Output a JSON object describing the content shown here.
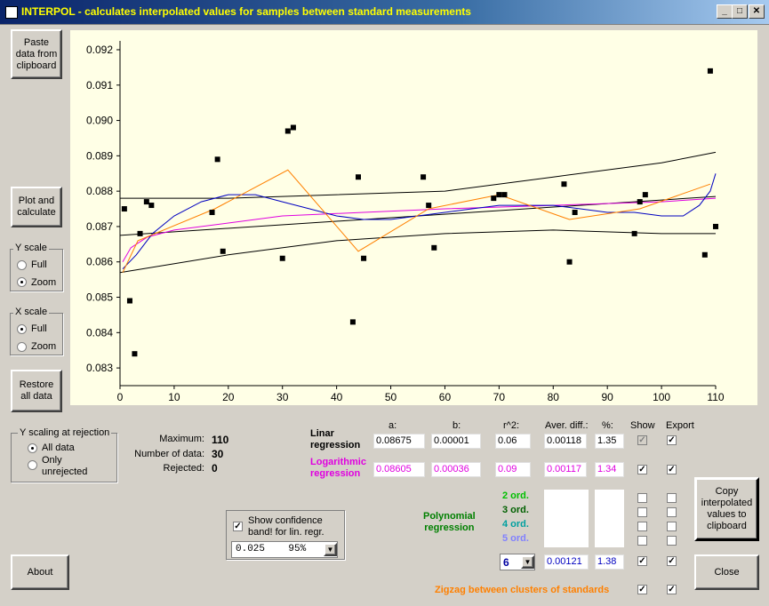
{
  "window": {
    "title": "INTERPOL - calculates interpolated values for samples between standard measurements"
  },
  "buttons": {
    "paste": "Paste\ndata from\nclipboard",
    "plot": "Plot and\ncalculate",
    "restore": "Restore\nall data",
    "about": "About",
    "copy": "Copy\ninterpolated\nvalues to\nclipboard",
    "close": "Close"
  },
  "yscale": {
    "title": "Y scale",
    "options": [
      "Full",
      "Zoom"
    ],
    "selected": "Zoom"
  },
  "xscale": {
    "title": "X scale",
    "options": [
      "Full",
      "Zoom"
    ],
    "selected": "Full"
  },
  "yreject": {
    "title": "Y scaling at rejection",
    "opt1": "All data",
    "opt2": "Only\nunrejected",
    "selected": "All data"
  },
  "stats": {
    "max_label": "Maximum:",
    "max": "110",
    "n_label": "Number of data:",
    "n": "30",
    "rej_label": "Rejected:",
    "rej": "0"
  },
  "headers": {
    "a": "a:",
    "b": "b:",
    "r2": "r^2:",
    "aver": "Aver. diff.:",
    "pct": "%:",
    "show": "Show",
    "export": "Export"
  },
  "linear": {
    "label": "Linar\nregression",
    "a": "0.08675",
    "b": "0.00001",
    "r2": "0.06",
    "aver": "0.00118",
    "pct": "1.35"
  },
  "log": {
    "label": "Logarithmic\nregression",
    "a": "0.08605",
    "b": "0.00036",
    "r2": "0.09",
    "aver": "0.00117",
    "pct": "1.34"
  },
  "poly": {
    "label": "Polynomial\nregression",
    "ord2": "2 ord.",
    "ord3": "3 ord.",
    "ord4": "4 ord.",
    "ord5": "5 ord.",
    "order": "6",
    "aver": "0.00121",
    "pct": "1.38"
  },
  "zigzag": {
    "label": "Zigzag between clusters of standards"
  },
  "confidence": {
    "label": "Show confidence\nband! for lin. regr.",
    "value": "0.025    95%"
  },
  "colors": {
    "magenta": "#e000e0",
    "green": "#008000",
    "teal": "#00a0a0",
    "violet": "#8080ff",
    "orange": "#ff8000",
    "blue": "#0000c0"
  },
  "chart_data": {
    "type": "scatter",
    "xlim": [
      0,
      110
    ],
    "ylim": [
      0.0825,
      0.0921
    ],
    "x_ticks": [
      "0",
      "10",
      "20",
      "30",
      "40",
      "50",
      "60",
      "70",
      "80",
      "90",
      "100",
      "110"
    ],
    "y_ticks": [
      "0.083",
      "0.084",
      "0.085",
      "0.086",
      "0.087",
      "0.088",
      "0.089",
      "0.090",
      "0.091",
      "0.092"
    ],
    "points": [
      [
        0.8,
        0.0875
      ],
      [
        1.8,
        0.0849
      ],
      [
        2.7,
        0.0834
      ],
      [
        3.7,
        0.0868
      ],
      [
        4.9,
        0.0877
      ],
      [
        5.8,
        0.0876
      ],
      [
        17,
        0.0874
      ],
      [
        18,
        0.0889
      ],
      [
        19,
        0.0863
      ],
      [
        30,
        0.0861
      ],
      [
        31,
        0.0897
      ],
      [
        32,
        0.0898
      ],
      [
        43,
        0.0843
      ],
      [
        44,
        0.0884
      ],
      [
        45,
        0.0861
      ],
      [
        56,
        0.0884
      ],
      [
        57,
        0.0876
      ],
      [
        58,
        0.0864
      ],
      [
        69,
        0.0878
      ],
      [
        70,
        0.0879
      ],
      [
        71,
        0.0879
      ],
      [
        82,
        0.0882
      ],
      [
        83,
        0.086
      ],
      [
        84,
        0.0874
      ],
      [
        95,
        0.0868
      ],
      [
        96,
        0.0877
      ],
      [
        97,
        0.0879
      ],
      [
        108,
        0.0862
      ],
      [
        109,
        0.0914
      ],
      [
        110,
        0.087
      ]
    ],
    "lines": {
      "linear": [
        [
          0,
          0.08675
        ],
        [
          110,
          0.08785
        ]
      ],
      "conf_upper": [
        [
          0,
          0.0878
        ],
        [
          20,
          0.0878
        ],
        [
          40,
          0.0879
        ],
        [
          60,
          0.088
        ],
        [
          80,
          0.0884
        ],
        [
          100,
          0.0888
        ],
        [
          110,
          0.0891
        ]
      ],
      "conf_lower": [
        [
          0,
          0.0857
        ],
        [
          20,
          0.0862
        ],
        [
          40,
          0.0866
        ],
        [
          60,
          0.0868
        ],
        [
          80,
          0.0869
        ],
        [
          100,
          0.0868
        ],
        [
          110,
          0.0868
        ]
      ],
      "log": [
        [
          0.5,
          0.086
        ],
        [
          2,
          0.0864
        ],
        [
          5,
          0.0867
        ],
        [
          10,
          0.0869
        ],
        [
          20,
          0.0871
        ],
        [
          30,
          0.0873
        ],
        [
          45,
          0.0874
        ],
        [
          60,
          0.0875
        ],
        [
          80,
          0.0876
        ],
        [
          100,
          0.0877
        ],
        [
          110,
          0.0878
        ]
      ],
      "poly6": [
        [
          0.5,
          0.0858
        ],
        [
          3,
          0.0862
        ],
        [
          6,
          0.0868
        ],
        [
          10,
          0.0873
        ],
        [
          15,
          0.0877
        ],
        [
          20,
          0.0879
        ],
        [
          25,
          0.0879
        ],
        [
          30,
          0.0877
        ],
        [
          35,
          0.0875
        ],
        [
          40,
          0.0873
        ],
        [
          45,
          0.0872
        ],
        [
          50,
          0.0872
        ],
        [
          55,
          0.0873
        ],
        [
          60,
          0.0874
        ],
        [
          65,
          0.0875
        ],
        [
          70,
          0.0876
        ],
        [
          75,
          0.0876
        ],
        [
          80,
          0.0876
        ],
        [
          85,
          0.0875
        ],
        [
          90,
          0.0874
        ],
        [
          95,
          0.0874
        ],
        [
          100,
          0.0873
        ],
        [
          104,
          0.0873
        ],
        [
          107,
          0.0876
        ],
        [
          109,
          0.088
        ],
        [
          110,
          0.0885
        ]
      ],
      "zigzag": [
        [
          0.5,
          0.0857
        ],
        [
          3.3,
          0.0866
        ],
        [
          17.5,
          0.0875
        ],
        [
          31,
          0.0886
        ],
        [
          44,
          0.0863
        ],
        [
          57,
          0.0875
        ],
        [
          70,
          0.0879
        ],
        [
          83,
          0.0872
        ],
        [
          96,
          0.0875
        ],
        [
          109,
          0.0882
        ]
      ]
    }
  }
}
